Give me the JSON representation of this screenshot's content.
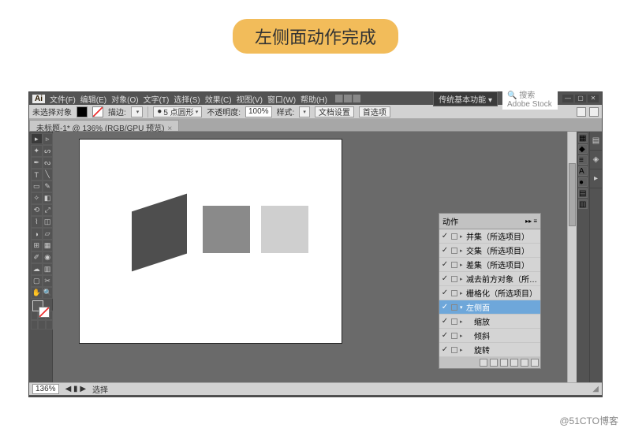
{
  "banner": "左侧面动作完成",
  "menubar": {
    "logo": "Ai",
    "items": [
      "文件(F)",
      "编辑(E)",
      "对象(O)",
      "文字(T)",
      "选择(S)",
      "效果(C)",
      "视图(V)",
      "窗口(W)",
      "帮助(H)"
    ],
    "workspace": "传统基本功能",
    "search_placeholder": "搜索 Adobe Stock"
  },
  "controlbar": {
    "selection_label": "未选择对象",
    "stroke_label": "描边:",
    "stroke_value": "",
    "point_label": "5 点圆形",
    "opacity_label": "不透明度:",
    "opacity_value": "100%",
    "style_label": "样式:",
    "doc_setup": "文档设置",
    "prefs": "首选项"
  },
  "tab": {
    "title": "未标题-1* @ 136% (RGB/GPU 预览)"
  },
  "actions_panel": {
    "title": "动作",
    "items": [
      {
        "label": "并集（所选项目）",
        "checked": true,
        "expand": "▸"
      },
      {
        "label": "交集（所选项目）",
        "checked": true,
        "expand": "▸"
      },
      {
        "label": "差集（所选项目）",
        "checked": true,
        "expand": "▸"
      },
      {
        "label": "减去前方对象（所…",
        "checked": true,
        "expand": "▸"
      },
      {
        "label": "栅格化（所选项目）",
        "checked": true,
        "expand": "▸"
      },
      {
        "label": "左侧面",
        "checked": true,
        "expand": "▾",
        "selected": true
      },
      {
        "label": "缩放",
        "checked": true,
        "expand": "▸",
        "indent": true
      },
      {
        "label": "倾斜",
        "checked": true,
        "expand": "▸",
        "indent": true
      },
      {
        "label": "旋转",
        "checked": true,
        "expand": "▸",
        "indent": true
      }
    ]
  },
  "statusbar": {
    "zoom": "136%",
    "nav": "◀ ▮ ▶",
    "sel_label": "选择"
  },
  "dock_icons": [
    "▦",
    "◆",
    "≡",
    "A",
    "●",
    "▤",
    "▥"
  ],
  "far_icons": [
    "▤",
    "◈",
    "▸"
  ],
  "watermark": "@51CTO博客"
}
